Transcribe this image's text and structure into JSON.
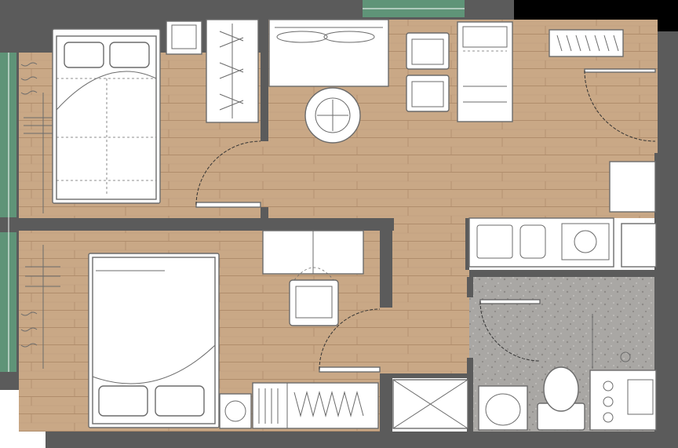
{
  "plan": {
    "colors": {
      "background": "#ffffff",
      "wall": "#5b5b5b",
      "wood_floor": "#c9a886",
      "wood_line": "#b08d6c",
      "stone_floor": "#a9a7a4",
      "window_glass": "#5f9478",
      "black_area": "#000000",
      "furniture_fill": "#ffffff",
      "furniture_line": "#6b6b6b",
      "door_swing": "#333333"
    },
    "rooms": [
      {
        "id": "bedroom-1",
        "floor": "wood"
      },
      {
        "id": "living-area",
        "floor": "wood"
      },
      {
        "id": "bedroom-2",
        "floor": "wood"
      },
      {
        "id": "corridor",
        "floor": "wood"
      },
      {
        "id": "bathroom",
        "floor": "stone"
      },
      {
        "id": "kitchen",
        "floor": "white"
      }
    ],
    "furniture": [
      {
        "name": "double-bed-1",
        "room": "bedroom-1"
      },
      {
        "name": "nightstand-1",
        "room": "bedroom-1"
      },
      {
        "name": "wardrobe-1",
        "room": "bedroom-1"
      },
      {
        "name": "sofa",
        "room": "living-area"
      },
      {
        "name": "coffee-table",
        "room": "living-area"
      },
      {
        "name": "armchair-1",
        "room": "living-area"
      },
      {
        "name": "armchair-2",
        "room": "living-area"
      },
      {
        "name": "daybed",
        "room": "living-area"
      },
      {
        "name": "shoe-rack",
        "room": "living-area"
      },
      {
        "name": "fridge",
        "room": "kitchen"
      },
      {
        "name": "kitchen-counter",
        "room": "kitchen"
      },
      {
        "name": "sink",
        "room": "kitchen"
      },
      {
        "name": "hob",
        "room": "kitchen"
      },
      {
        "name": "double-bed-2",
        "room": "bedroom-2"
      },
      {
        "name": "desk",
        "room": "bedroom-2"
      },
      {
        "name": "desk-chair",
        "room": "bedroom-2"
      },
      {
        "name": "wardrobe-2",
        "room": "bedroom-2"
      },
      {
        "name": "washing-machine",
        "room": "bedroom-2"
      },
      {
        "name": "storage-cabinet",
        "room": "corridor"
      },
      {
        "name": "shower",
        "room": "bathroom"
      },
      {
        "name": "toilet",
        "room": "bathroom"
      },
      {
        "name": "wash-basin",
        "room": "bathroom"
      },
      {
        "name": "bath-cabinet",
        "room": "bathroom"
      }
    ],
    "doors": [
      {
        "name": "entrance-door"
      },
      {
        "name": "bedroom-1-door"
      },
      {
        "name": "bedroom-2-door"
      },
      {
        "name": "bathroom-door"
      }
    ],
    "windows": [
      {
        "name": "window-left-upper"
      },
      {
        "name": "window-left-lower"
      },
      {
        "name": "window-top"
      }
    ]
  }
}
